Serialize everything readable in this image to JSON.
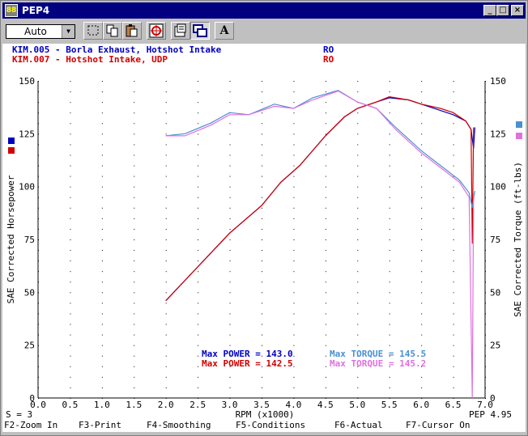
{
  "window": {
    "title": "PEP4",
    "icon_label": "88"
  },
  "titlebar_buttons": {
    "minimize": "_",
    "maximize": "□",
    "close": "×"
  },
  "toolbar": {
    "zoom_value": "Auto",
    "tools": [
      {
        "name": "select-tool",
        "icon": "dashed-rect-icon"
      },
      {
        "name": "copy-tool",
        "icon": "copy-icon"
      },
      {
        "name": "paste-tool",
        "icon": "paste-icon"
      },
      {
        "name": "zoom-fit-tool",
        "icon": "target-icon"
      },
      {
        "name": "properties-tool",
        "icon": "properties-icon"
      },
      {
        "name": "overlay-tool",
        "icon": "windows-icon"
      },
      {
        "name": "font-tool",
        "icon": "letter-a-icon",
        "label": "A"
      }
    ]
  },
  "runs": [
    {
      "id": "KIM.005",
      "desc": "KIM.005 - Borla Exhaust, Hotshot Intake",
      "flag": "RO",
      "color": "#0000c0"
    },
    {
      "id": "KIM.007",
      "desc": "KIM.007 - Hotshot Intake, UDP",
      "flag": "RO",
      "color": "#d00000"
    }
  ],
  "stats": {
    "power1": "Max POWER = 143.0",
    "power2": "Max POWER = 142.5",
    "torque1": "Max TORQUE = 145.5",
    "torque2": "Max TORQUE = 145.2"
  },
  "corner": {
    "smoothing": "S = 3",
    "version": "PEP 4.95"
  },
  "function_keys": [
    "F2-Zoom In",
    "F3-Print",
    "F4-Smoothing",
    "F5-Conditions",
    "F6-Actual",
    "F7-Cursor On"
  ],
  "chart_data": {
    "type": "line",
    "xlabel": "RPM (x1000)",
    "ylabel": "SAE Corrected Horsepower",
    "y2label": "SAE Corrected Torque (ft-lbs)",
    "xlim": [
      0,
      7
    ],
    "ylim": [
      0,
      150
    ],
    "x_ticks": [
      "0.0",
      "0.5",
      "1.0",
      "1.5",
      "2.0",
      "2.5",
      "3.0",
      "3.5",
      "4.0",
      "4.5",
      "5.0",
      "5.5",
      "6.0",
      "6.5",
      "7.0"
    ],
    "y_ticks": [
      "0",
      "25",
      "50",
      "75",
      "100",
      "125",
      "150"
    ],
    "grid": "dotted",
    "series": [
      {
        "name": "KIM.005",
        "kind": "power",
        "color": "#0000c0",
        "x": [
          2.0,
          2.5,
          3.0,
          3.5,
          3.8,
          4.1,
          4.5,
          4.8,
          5.0,
          5.3,
          5.5,
          5.8,
          6.0,
          6.3,
          6.5,
          6.7,
          6.78,
          6.82,
          6.84
        ],
        "y": [
          46,
          62,
          78,
          91,
          102,
          110,
          124,
          133,
          137,
          140,
          142,
          141,
          139,
          136,
          134,
          131,
          127,
          118,
          128
        ]
      },
      {
        "name": "KIM.007",
        "kind": "power",
        "color": "#d00000",
        "x": [
          2.0,
          2.5,
          3.0,
          3.5,
          3.8,
          4.1,
          4.5,
          4.8,
          5.0,
          5.3,
          5.5,
          5.8,
          6.0,
          6.3,
          6.5,
          6.7,
          6.78,
          6.8,
          6.82
        ],
        "y": [
          46,
          62,
          78,
          91,
          102,
          110,
          124,
          133,
          137,
          140,
          142.5,
          141,
          139,
          137,
          135,
          131,
          127,
          73,
          128
        ]
      },
      {
        "name": "KIM.005",
        "kind": "torque",
        "color": "#4a90d0",
        "x": [
          2.0,
          2.3,
          2.7,
          3.0,
          3.3,
          3.7,
          4.0,
          4.3,
          4.7,
          5.0,
          5.3,
          5.6,
          6.0,
          6.3,
          6.6,
          6.75,
          6.8,
          6.84
        ],
        "y": [
          124,
          125,
          130,
          135,
          134,
          139,
          137,
          142,
          145.5,
          140,
          137,
          128,
          117,
          110,
          103,
          97,
          90,
          98
        ]
      },
      {
        "name": "KIM.007",
        "kind": "torque",
        "color": "#e070e0",
        "x": [
          2.0,
          2.3,
          2.7,
          3.0,
          3.3,
          3.7,
          4.0,
          4.3,
          4.7,
          5.0,
          5.3,
          5.6,
          6.0,
          6.3,
          6.6,
          6.75,
          6.8,
          6.82
        ],
        "y": [
          124,
          124,
          129,
          134,
          134,
          138,
          137,
          141,
          145.2,
          140,
          137,
          127,
          116,
          109,
          102,
          95,
          0,
          97
        ]
      }
    ]
  }
}
